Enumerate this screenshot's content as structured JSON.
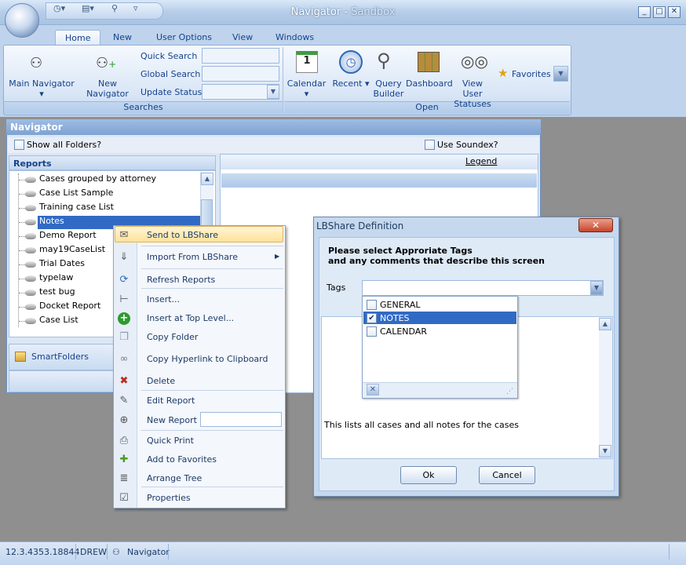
{
  "window": {
    "title": "Navigator",
    "subtitle": "Sandbox",
    "controls": [
      "minimize",
      "maximize",
      "close"
    ]
  },
  "quick_access": {
    "icons": [
      "clock-icon",
      "report-icon",
      "search-icon",
      "customize-icon"
    ]
  },
  "tabs": [
    "Home",
    "New",
    "User Options",
    "View",
    "Windows"
  ],
  "ribbon": {
    "searches": {
      "label": "Searches",
      "main_navigator": "Main Navigator",
      "new_navigator": "New Navigator",
      "quick_search": "Quick Search",
      "global_search": "Global Search",
      "update_status": "Update Status"
    },
    "open": {
      "label": "Open",
      "calendar": "Calendar",
      "recent": "Recent",
      "query_builder_1": "Query",
      "query_builder_2": "Builder",
      "dashboard": "Dashboard",
      "view_user_statuses_1": "View User",
      "view_user_statuses_2": "Statuses",
      "favorites": "Favorites"
    }
  },
  "navigator": {
    "title": "Navigator",
    "show_all_folders": "Show all Folders?",
    "use_soundex": "Use Soundex?",
    "reports_header": "Reports",
    "legend": "Legend",
    "smart_folders": "SmartFolders",
    "reports": [
      "Cases grouped by attorney",
      "Case List Sample",
      "Training case List",
      "Notes",
      "Demo Report",
      "may19CaseList",
      "Trial Dates",
      "typelaw",
      "test bug",
      "Docket Report",
      "Case List"
    ],
    "selected_report": "Notes"
  },
  "context_menu": {
    "items": [
      {
        "label": "Send to LBShare",
        "icon": "share-icon"
      },
      {
        "label": "Import From LBShare",
        "icon": "import-icon"
      },
      {
        "label": "Refresh Reports",
        "icon": "refresh-icon"
      },
      {
        "label": "Insert...",
        "icon": "insert-icon"
      },
      {
        "label": "Insert at Top Level...",
        "icon": "add-icon"
      },
      {
        "label": "Copy Folder",
        "icon": "copy-icon"
      },
      {
        "label": "Copy Hyperlink to Clipboard",
        "icon": "link-icon"
      },
      {
        "label": "Delete",
        "icon": "delete-icon"
      },
      {
        "label": "Edit Report",
        "icon": "pencil-icon"
      },
      {
        "label": "New Report",
        "icon": "new-report-icon"
      },
      {
        "label": "Quick Print",
        "icon": "print-icon"
      },
      {
        "label": "Add to Favorites",
        "icon": "favorite-icon"
      },
      {
        "label": "Arrange Tree",
        "icon": "tree-icon"
      },
      {
        "label": "Properties",
        "icon": "properties-icon"
      }
    ],
    "new_report_value": ""
  },
  "dialog": {
    "title": "LBShare Definition",
    "prompt_line1": "Please select Approriate Tags",
    "prompt_line2": "and any comments that describe this screen",
    "tags_label": "Tags",
    "tags": [
      {
        "label": "GENERAL",
        "checked": false
      },
      {
        "label": "NOTES",
        "checked": true
      },
      {
        "label": "CALENDAR",
        "checked": false
      }
    ],
    "comment": "This lists all cases and all notes for the cases",
    "ok": "Ok",
    "cancel": "Cancel"
  },
  "status_bar": {
    "version": "12.3.4353.18844",
    "user": "DREW",
    "module": "Navigator"
  }
}
